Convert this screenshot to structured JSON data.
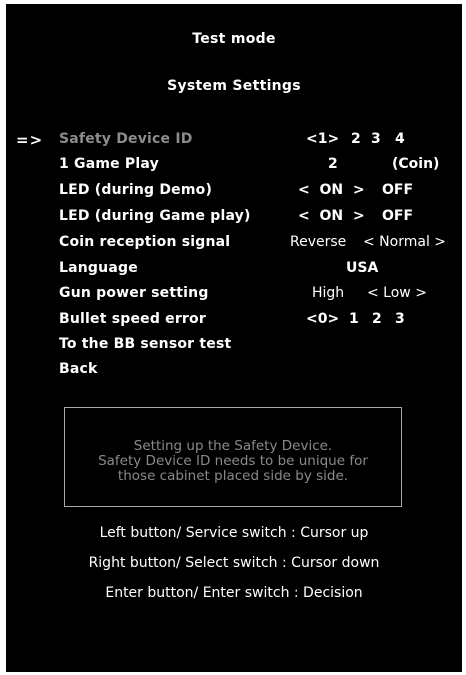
{
  "header": {
    "title": "Test mode",
    "subtitle": "System Settings"
  },
  "cursor": "=>",
  "menu": [
    {
      "label": "Safety Device ID",
      "selected": true
    },
    {
      "label": "1 Game Play"
    },
    {
      "label": "LED (during Demo)"
    },
    {
      "label": "LED (during Game play)"
    },
    {
      "label": "Coin reception signal"
    },
    {
      "label": "Language"
    },
    {
      "label": "Gun power setting"
    },
    {
      "label": "Bullet speed error"
    },
    {
      "label": "To the BB sensor test"
    },
    {
      "label": "Back"
    }
  ],
  "values": {
    "safety_device_id": {
      "selected": "<1>",
      "options": [
        "2",
        "3",
        "4"
      ]
    },
    "game_play": {
      "count": "2",
      "unit": "(Coin)"
    },
    "led_demo": {
      "selected": "<  ON  >",
      "other": "OFF"
    },
    "led_game": {
      "selected": "<  ON  >",
      "other": "OFF"
    },
    "coin_signal": {
      "other": "Reverse",
      "selected": "< Normal >"
    },
    "language": {
      "selected": "USA"
    },
    "gun_power": {
      "other": "High",
      "selected": "< Low >"
    },
    "bullet_speed": {
      "selected": "<0>",
      "options": [
        "1",
        "2",
        "3"
      ]
    }
  },
  "info_box": {
    "lines": [
      "Setting up the Safety Device.",
      "Safety Device ID needs to be unique for",
      "those cabinet placed side by side."
    ]
  },
  "help": [
    "Left button/ Service switch : Cursor up",
    "Right button/ Select switch : Cursor down",
    "Enter button/ Enter switch : Decision"
  ]
}
